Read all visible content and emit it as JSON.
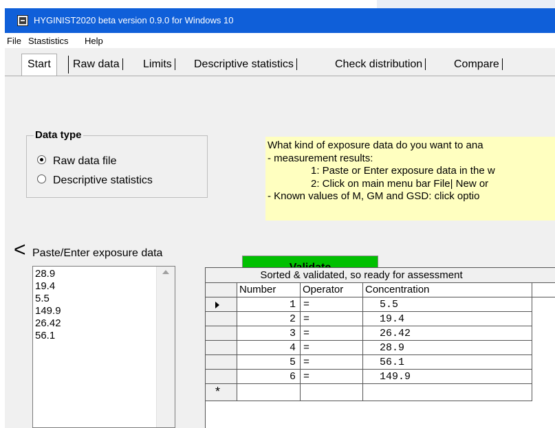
{
  "window": {
    "title": "HYGINIST2020  beta version 0.9.0   for Windows 10",
    "icon": "app-icon"
  },
  "menu": [
    "File",
    "Stastistics",
    "Help"
  ],
  "tabs": [
    "Start",
    "Raw data",
    "Limits",
    "Descriptive statistics",
    "Check distribution",
    "Compare"
  ],
  "active_tab": "Start",
  "data_type": {
    "label": "Data type",
    "options": [
      {
        "label": "Raw data file",
        "checked": true
      },
      {
        "label": "Descriptive statistics",
        "checked": false
      }
    ]
  },
  "help": {
    "lines": [
      "What kind of exposure data do you want to ana",
      "- measurement results:",
      "1: Paste or Enter exposure data in the w",
      "2: Click on main menu bar File| New or",
      "- Known values of M, GM and GSD: click optio"
    ],
    "background": "#ffffc0"
  },
  "paste": {
    "label": "Paste/Enter exposure data",
    "values": [
      "28.9",
      "19.4",
      "5.5",
      "149.9",
      "26.42",
      "56.1"
    ]
  },
  "validate_button": {
    "label": "Validate",
    "color": "#00c000"
  },
  "grid": {
    "caption": "Sorted & validated, so ready for assessment",
    "columns": [
      "Number",
      "Operator",
      "Concentration"
    ],
    "rows": [
      {
        "number": "1",
        "operator": "=",
        "concentration": "5.5"
      },
      {
        "number": "2",
        "operator": "=",
        "concentration": "19.4"
      },
      {
        "number": "3",
        "operator": "=",
        "concentration": "26.42"
      },
      {
        "number": "4",
        "operator": "=",
        "concentration": "28.9"
      },
      {
        "number": "5",
        "operator": "=",
        "concentration": "56.1"
      },
      {
        "number": "6",
        "operator": "=",
        "concentration": "149.9"
      }
    ],
    "new_row_marker": "*"
  },
  "left_caret": "<",
  "colors": {
    "titlebar": "#0f5fd9",
    "window": "#f0f0f0"
  }
}
